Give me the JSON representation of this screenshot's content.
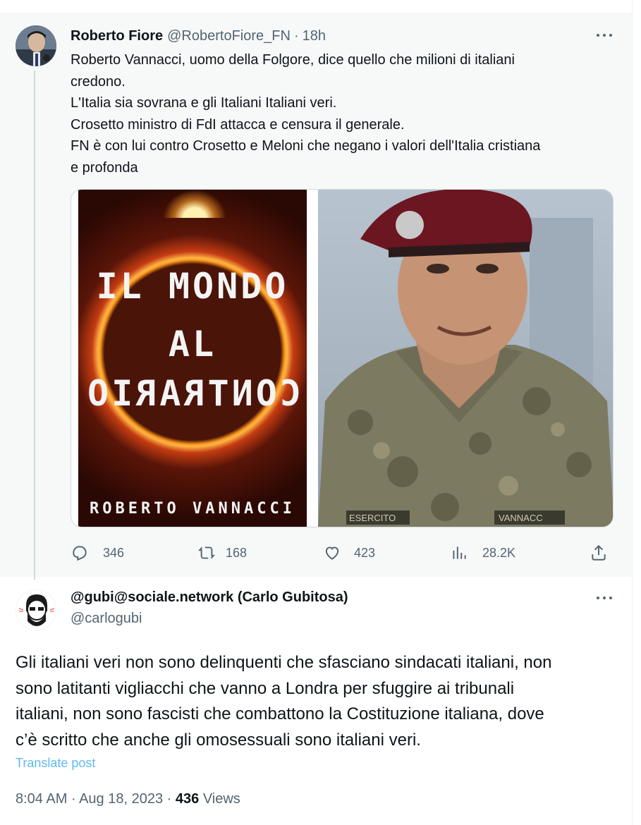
{
  "parent_post": {
    "author_name": "Roberto Fiore",
    "author_handle": "@RobertoFiore_FN",
    "separator": "·",
    "time": "18h",
    "text_lines": [
      "Roberto Vannacci, uomo della Folgore, dice quello che milioni di italiani",
      "credono.",
      "L'Italia sia sovrana e gli Italiani Italiani veri.",
      "Crosetto ministro di FdI attacca e censura il generale.",
      "FN è con lui contro Crosetto e Meloni che negano i valori dell'Italia cristiana",
      "e profonda"
    ],
    "book_cover": {
      "title_line1": "IL MONDO",
      "title_line2": "AL",
      "title_line3": "CONTRARIO",
      "author": "ROBERTO VANNACCI"
    },
    "photo_patches": {
      "left": "ESERCITO",
      "right": "VANNACC"
    },
    "actions": {
      "replies": "346",
      "reposts": "168",
      "likes": "423",
      "views": "28.2K"
    }
  },
  "main_post": {
    "author_name": "@gubi@sociale.network (Carlo Gubitosa)",
    "author_handle": "@carlogubi",
    "text_lines": [
      "Gli italiani veri non sono delinquenti che sfasciano sindacati italiani, non",
      "sono latitanti vigliacchi che vanno a Londra per sfuggire ai tribunali",
      "italiani, non sono fascisti che combattono la Costituzione italiana, dove",
      "c’è scritto che anche gli omosessuali sono italiani veri."
    ],
    "translate_label": "Translate post",
    "time": "8:04 AM",
    "date": "Aug 18, 2023",
    "separator": "·",
    "views_count": "436",
    "views_label": "Views"
  },
  "icons": {
    "reply": "reply-icon",
    "repost": "repost-icon",
    "like": "heart-icon",
    "views": "analytics-icon",
    "share": "share-icon",
    "more": "more-icon"
  },
  "colors": {
    "link": "#1d9bf0",
    "secondary_text": "#536471",
    "primary_text": "#0f1419"
  }
}
